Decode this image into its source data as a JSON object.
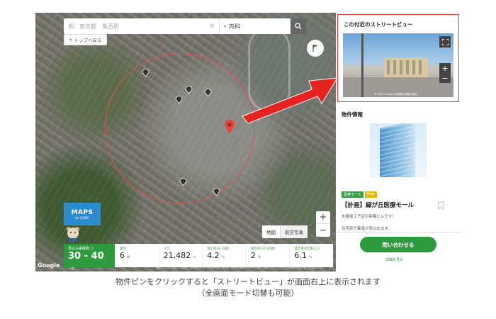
{
  "search": {
    "placeholder": "例：東京都　亀西駅",
    "clear_icon": "close-icon",
    "category_value": "内科",
    "search_icon": "search-icon"
  },
  "map": {
    "back_to_top": "トップへ戻る",
    "map_type": [
      "地図",
      "航空写真"
    ],
    "zoom_in": "+",
    "zoom_out": "−",
    "logo_main": "MAPS",
    "logo_sub": "for CLINIC",
    "google": "Google",
    "attribution": "画像 ©2021 CNES / Airbus, Digital Earth Technology, Maxar Technologies, Planet.com, 地図データ ©2021 利用規約 地図の誤りを報告する"
  },
  "stats": {
    "main": {
      "label": "見込み来院数",
      "value": "30 - 40",
      "unit": "人/日"
    },
    "items": [
      {
        "label": "競合",
        "value": "6",
        "unit": "軒"
      },
      {
        "label": "人口",
        "value": "21,482",
        "unit": "人"
      },
      {
        "label": "受診率(0-14歳)",
        "value": "4.2",
        "unit": "%"
      },
      {
        "label": "受診率(15-64歳)",
        "value": "2",
        "unit": "%"
      },
      {
        "label": "受診率(65歳以上)",
        "value": "6.1",
        "unit": "%"
      }
    ]
  },
  "panel": {
    "streetview_title": "この付近のストリートビュー",
    "streetview_copy": "© 2020 Google  利用規約  問題の報告",
    "info_title": "物件情報",
    "tags": [
      "医療モール",
      "New"
    ],
    "property_name": "【計画】緑が丘医療モール",
    "desc1": "未着竣工予定の新築ビルです！",
    "desc2": "住宅街で集患が見込めます。",
    "contact": "問い合わせる",
    "detail": "詳細を見る"
  },
  "caption": {
    "line1": "物件ピンをクリックすると「ストリートビュー」が画面右上に表示されます",
    "line2": "（全画面モード切替も可能）"
  },
  "colors": {
    "accent_green": "#2e9a3e",
    "highlight_red": "#e23b3b",
    "circle_red": "#e8504d"
  }
}
